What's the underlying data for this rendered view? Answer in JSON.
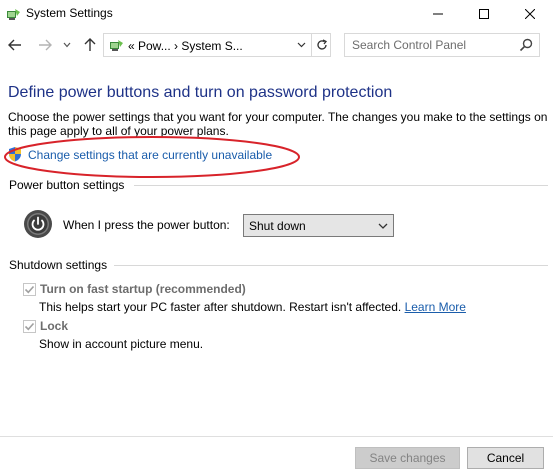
{
  "window": {
    "title": "System Settings",
    "app_icon": "control-panel-icon",
    "controls": [
      "minimize-icon",
      "maximize-icon",
      "close-icon"
    ]
  },
  "navbar": {
    "back_icon": "arrow-left-icon",
    "forward_icon": "arrow-right-icon",
    "recent_icon": "chevron-down-icon",
    "up_icon": "arrow-up-icon",
    "address_text": "«  Pow...  ›  System S...",
    "refresh_icon": "refresh-icon",
    "search_placeholder": "Search Control Panel",
    "search_value": ""
  },
  "main": {
    "title": "Define power buttons and turn on password protection",
    "intro": "Choose the power settings that you want for your computer. The changes you make to the settings on this page apply to all of your power plans.",
    "change_link": "Change settings that are currently unavailable",
    "highlight_color": "#d8232a",
    "link_color": "#1a5dab",
    "title_color": "#1e3287"
  },
  "power_section": {
    "heading": "Power button settings",
    "label": "When I press the power button:",
    "selected": "Shut down"
  },
  "shutdown_section": {
    "heading": "Shutdown settings",
    "fast_startup": {
      "label": "Turn on fast startup (recommended)",
      "checked": true,
      "description": "This helps start your PC faster after shutdown. Restart isn't affected.",
      "link": "Learn More"
    },
    "lock": {
      "label": "Lock",
      "checked": true,
      "description": "Show in account picture menu."
    }
  },
  "footer": {
    "save_label": "Save changes",
    "cancel_label": "Cancel"
  }
}
